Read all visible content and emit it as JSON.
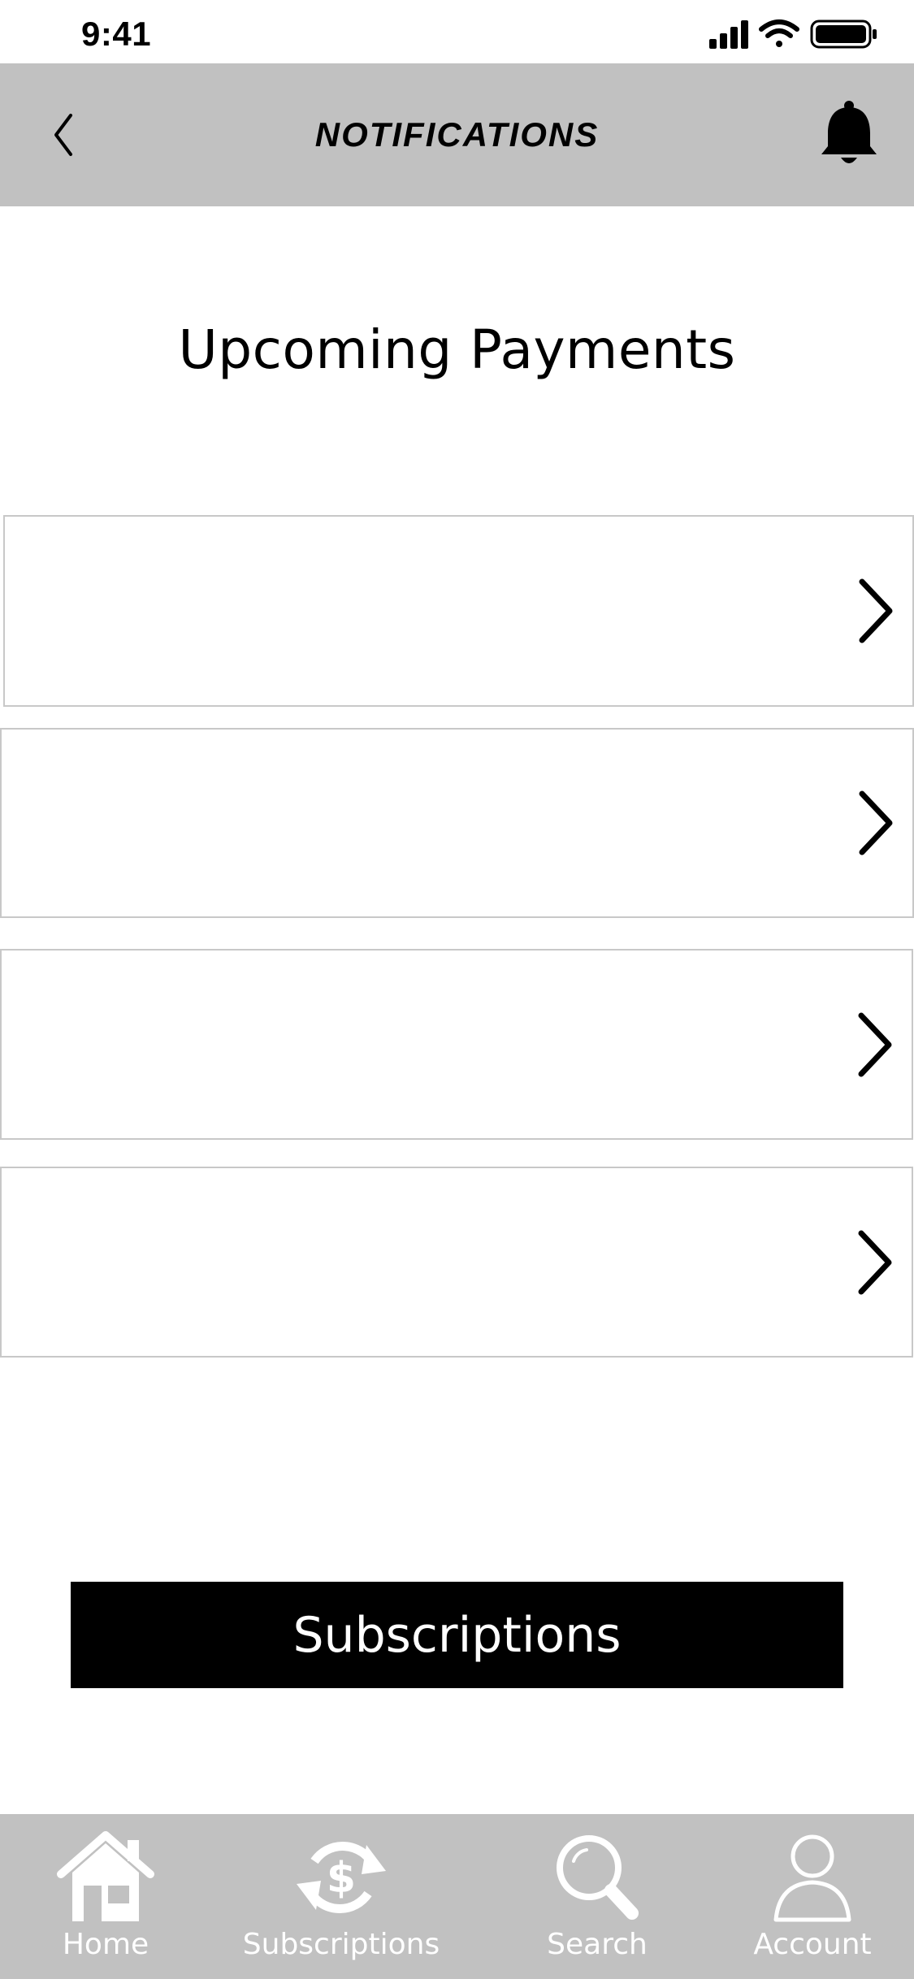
{
  "status_bar": {
    "time": "9:41"
  },
  "header": {
    "title": "NOTIFICATIONS",
    "back_icon": "chevron-left-icon",
    "bell_icon": "bell-icon",
    "background": "#c1c1c1"
  },
  "main": {
    "section_title": "Upcoming Payments",
    "rows": [
      {
        "icon": "chevron-right-icon"
      },
      {
        "icon": "chevron-right-icon"
      },
      {
        "icon": "chevron-right-icon"
      },
      {
        "icon": "chevron-right-icon"
      }
    ],
    "primary_button_label": "Subscriptions"
  },
  "tab_bar": {
    "background": "#c1c1c1",
    "tabs": [
      {
        "label": "Home",
        "icon": "home-icon"
      },
      {
        "label": "Subscriptions",
        "icon": "subscriptions-icon"
      },
      {
        "label": "Search",
        "icon": "search-icon"
      },
      {
        "label": "Account",
        "icon": "account-icon"
      }
    ]
  }
}
